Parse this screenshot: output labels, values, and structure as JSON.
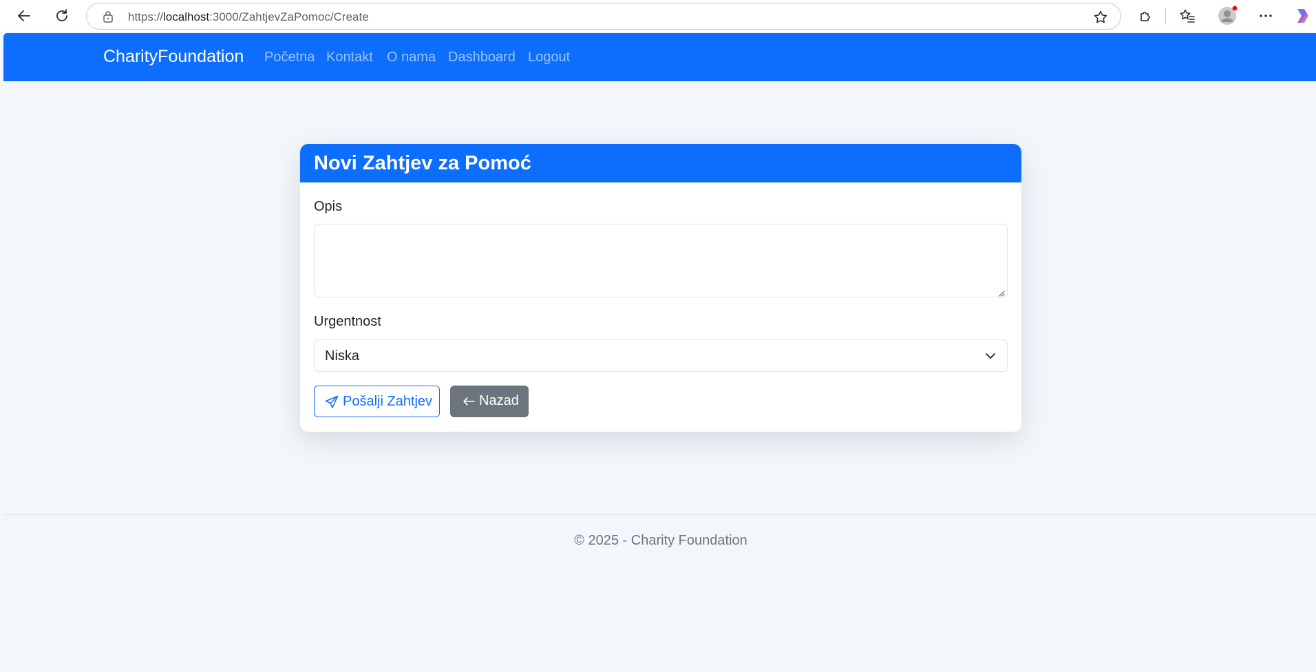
{
  "browser": {
    "url_prefix": "https://",
    "url_host": "localhost",
    "url_rest": ":3000/ZahtjevZaPomoc/Create",
    "icons": [
      "back-arrow-icon",
      "refresh-icon",
      "lock-icon",
      "star-icon",
      "extensions-icon",
      "favorites-icon",
      "profile-avatar-icon",
      "more-icon",
      "copilot-icon"
    ]
  },
  "navbar": {
    "brand": "CharityFoundation",
    "links": [
      "Početna",
      "Kontakt",
      "O nama",
      "Dashboard",
      "Logout"
    ],
    "background": "#0d6efd"
  },
  "form": {
    "title": "Novi Zahtjev za Pomoć",
    "description_label": "Opis",
    "description_value": "",
    "urgency_label": "Urgentnost",
    "urgency_selected": "Niska",
    "submit_label": "Pošalji Zahtjev",
    "submit_icon": "send-icon",
    "back_label": "Nazad",
    "back_icon": "arrow-left-icon"
  },
  "footer": {
    "text": "© 2025 - Charity Foundation"
  },
  "colors": {
    "primary": "#0d6efd",
    "secondary": "#6c757d",
    "page_background": "#f3f7fc"
  }
}
